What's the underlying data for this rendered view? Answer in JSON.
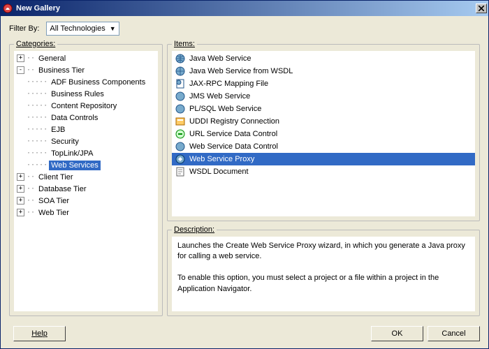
{
  "window": {
    "title": "New Gallery"
  },
  "filter": {
    "label": "Filter By:",
    "selected": "All Technologies"
  },
  "panels": {
    "categories": "Categories:",
    "items": "Items:",
    "description": "Description:"
  },
  "tree": {
    "general": "General",
    "business_tier": "Business Tier",
    "bt_children": {
      "adf": "ADF Business Components",
      "rules": "Business Rules",
      "content": "Content Repository",
      "datacontrols": "Data Controls",
      "ejb": "EJB",
      "security": "Security",
      "toplink": "TopLink/JPA",
      "webservices": "Web Services"
    },
    "client_tier": "Client Tier",
    "database_tier": "Database Tier",
    "soa_tier": "SOA Tier",
    "web_tier": "Web Tier"
  },
  "items": {
    "java_ws": "Java Web Service",
    "java_ws_wsdl": "Java Web Service from WSDL",
    "jaxrpc": "JAX-RPC Mapping File",
    "jms": "JMS Web Service",
    "plsql": "PL/SQL Web Service",
    "uddi": "UDDI Registry Connection",
    "url_dc": "URL Service Data Control",
    "ws_dc": "Web Service Data Control",
    "ws_proxy": "Web Service Proxy",
    "wsdl": "WSDL Document"
  },
  "description": {
    "p1": "Launches the Create Web Service Proxy wizard, in which you generate a Java proxy for calling a web service.",
    "p2": "To enable this option, you must select a project or a file within a project in the Application Navigator."
  },
  "buttons": {
    "help": "Help",
    "ok": "OK",
    "cancel": "Cancel"
  }
}
